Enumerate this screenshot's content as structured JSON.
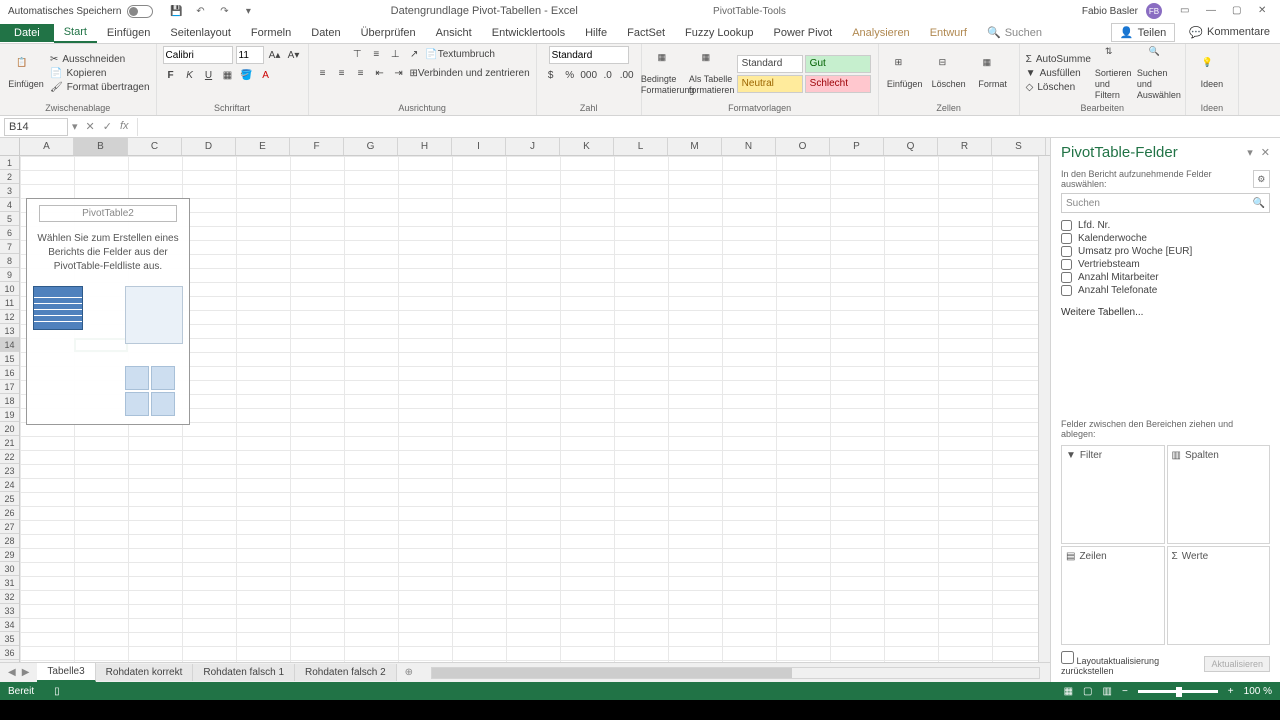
{
  "titlebar": {
    "autosave": "Automatisches Speichern",
    "doc_title": "Datengrundlage Pivot-Tabellen - Excel",
    "tools": "PivotTable-Tools",
    "user": "Fabio Basler",
    "initials": "FB"
  },
  "tabs": {
    "file": "Datei",
    "home": "Start",
    "insert": "Einfügen",
    "layout": "Seitenlayout",
    "formulas": "Formeln",
    "data": "Daten",
    "review": "Überprüfen",
    "view": "Ansicht",
    "developer": "Entwicklertools",
    "help": "Hilfe",
    "factset": "FactSet",
    "fuzzy": "Fuzzy Lookup",
    "powerpivot": "Power Pivot",
    "analyze": "Analysieren",
    "design": "Entwurf",
    "search": "Suchen",
    "share": "Teilen",
    "comments": "Kommentare"
  },
  "ribbon": {
    "paste": "Einfügen",
    "cut": "Ausschneiden",
    "copy": "Kopieren",
    "format_painter": "Format übertragen",
    "clipboard": "Zwischenablage",
    "font_name": "Calibri",
    "font_size": "11",
    "font_group": "Schriftart",
    "wrap": "Textumbruch",
    "merge": "Verbinden und zentrieren",
    "alignment": "Ausrichtung",
    "number_format": "Standard",
    "number_group": "Zahl",
    "cond_format": "Bedingte Formatierung",
    "as_table": "Als Tabelle formatieren",
    "style_standard": "Standard",
    "style_gut": "Gut",
    "style_neutral": "Neutral",
    "style_schlecht": "Schlecht",
    "styles_group": "Formatvorlagen",
    "insert_cells": "Einfügen",
    "delete": "Löschen",
    "format": "Format",
    "cells_group": "Zellen",
    "autosum": "AutoSumme",
    "fill": "Ausfüllen",
    "clear": "Löschen",
    "sort": "Sortieren und Filtern",
    "find": "Suchen und Auswählen",
    "editing": "Bearbeiten",
    "ideas": "Ideen",
    "ideas_group": "Ideen"
  },
  "namebox": "B14",
  "columns": [
    "A",
    "B",
    "C",
    "D",
    "E",
    "F",
    "G",
    "H",
    "I",
    "J",
    "K",
    "L",
    "M",
    "N",
    "O",
    "P",
    "Q",
    "R",
    "S"
  ],
  "pivot_placeholder": {
    "title": "PivotTable2",
    "text": "Wählen Sie zum Erstellen eines Berichts die Felder aus der PivotTable-Feldliste aus."
  },
  "taskpane": {
    "title": "PivotTable-Felder",
    "subtitle": "In den Bericht aufzunehmende Felder auswählen:",
    "search": "Suchen",
    "fields": [
      "Lfd. Nr.",
      "Kalenderwoche",
      "Umsatz pro Woche [EUR]",
      "Vertriebsteam",
      "Anzahl Mitarbeiter",
      "Anzahl Telefonate"
    ],
    "more": "Weitere Tabellen...",
    "areas_label": "Felder zwischen den Bereichen ziehen und ablegen:",
    "filter": "Filter",
    "columns": "Spalten",
    "rows": "Zeilen",
    "values": "Werte",
    "defer": "Layoutaktualisierung zurückstellen",
    "update": "Aktualisieren"
  },
  "sheets": {
    "active": "Tabelle3",
    "tabs": [
      "Rohdaten korrekt",
      "Rohdaten falsch 1",
      "Rohdaten falsch 2"
    ]
  },
  "status": {
    "ready": "Bereit",
    "zoom": "100 %"
  }
}
